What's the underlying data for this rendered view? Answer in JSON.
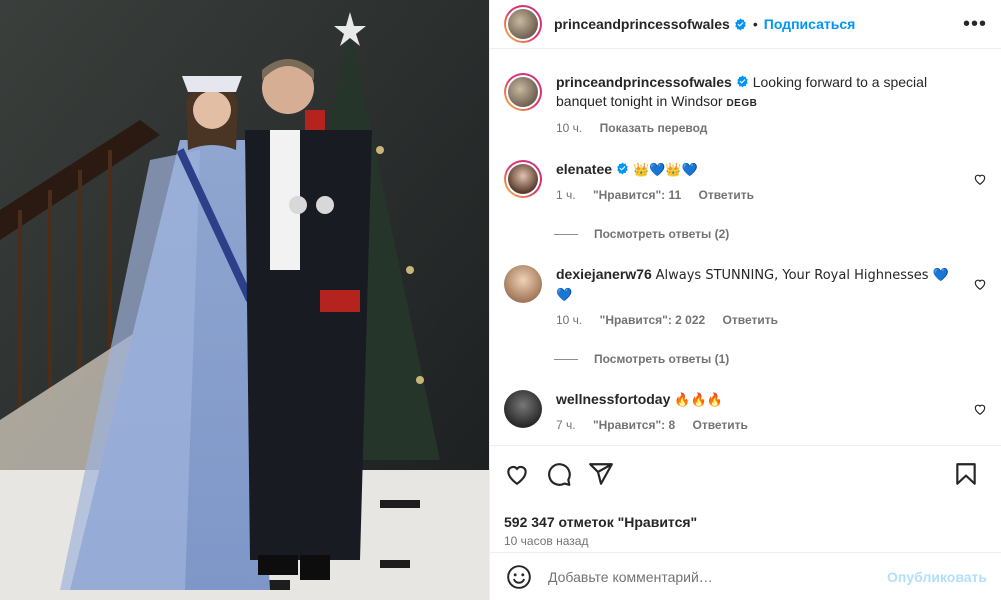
{
  "post": {
    "author": "princeandprincessofwales",
    "separator": "•",
    "follow_label": "Подписаться",
    "more_icon": "more-horizontal-icon",
    "caption": "Looking forward to a special banquet tonight in Windsor",
    "caption_flags": "DEGB",
    "caption_time": "10 ч.",
    "translate_label": "Показать перевод"
  },
  "comments": [
    {
      "user": "elenatee",
      "verified": true,
      "text": "👑💙👑💙",
      "time": "1 ч.",
      "likes": "\"Нравится\": 11",
      "reply": "Ответить",
      "view_replies": "Посмотреть ответы (2)"
    },
    {
      "user": "dexiejanerw76",
      "verified": false,
      "text": "Always STUNNING, Your Royal Highnesses 💙💙",
      "time": "10 ч.",
      "likes": "\"Нравится\": 2 022",
      "reply": "Ответить",
      "view_replies": "Посмотреть ответы (1)"
    },
    {
      "user": "wellnessfortoday",
      "verified": false,
      "text": "🔥🔥🔥",
      "time": "7 ч.",
      "likes": "\"Нравится\": 8",
      "reply": "Ответить"
    }
  ],
  "actions": {
    "likes_count": "592 347 отметок \"Нравится\"",
    "posted_ago": "10 часов назад"
  },
  "add_comment": {
    "placeholder": "Добавьте комментарий…",
    "publish_label": "Опубликовать"
  },
  "colors": {
    "accent": "#0095f6",
    "publish_disabled": "#b2dffc",
    "muted": "#737373"
  }
}
